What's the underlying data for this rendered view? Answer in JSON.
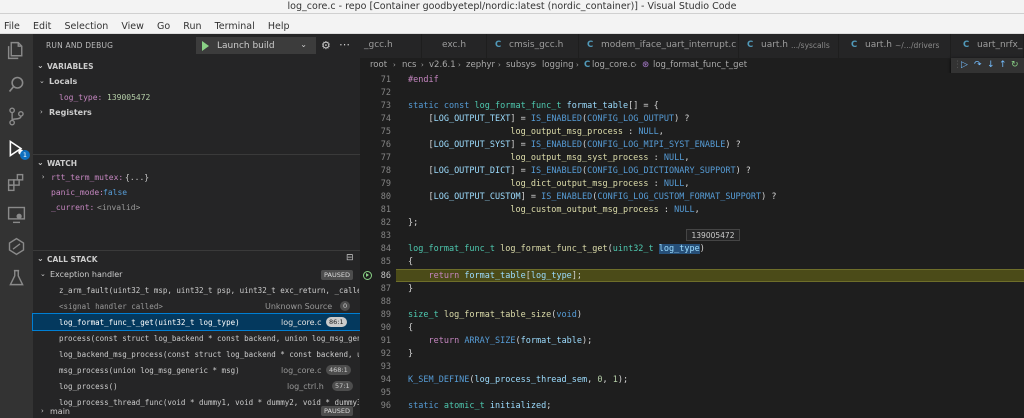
{
  "window": {
    "title": "log_core.c - repo [Container goodbyetepl/nordic:latest (nordic_container)] - Visual Studio Code",
    "menu": [
      "File",
      "Edit",
      "Selection",
      "View",
      "Go",
      "Run",
      "Terminal",
      "Help"
    ]
  },
  "activity": {
    "icons": [
      "explorer-icon",
      "search-icon",
      "source-control-icon",
      "run-debug-icon",
      "extensions-icon",
      "remote-explorer-icon",
      "nrf-connect-icon",
      "testing-icon"
    ],
    "debug_badge": "1"
  },
  "sidebar": {
    "title": "RUN AND DEBUG",
    "launch_label": "Launch build",
    "variables": {
      "title": "VARIABLES",
      "locals_label": "Locals",
      "local_name": "log_type:",
      "local_value": "139005472",
      "registers_label": "Registers"
    },
    "watch": {
      "title": "WATCH",
      "items": [
        {
          "name": "rtt_term_mutex:",
          "value": "{...}"
        },
        {
          "name": "panic_mode:",
          "value": "false"
        },
        {
          "name": "_current:",
          "value": "<invalid>"
        }
      ]
    },
    "call_stack": {
      "title": "CALL STACK",
      "thread_label": "Exception handler",
      "thread_status": "PAUSED",
      "frames": [
        {
          "fn": "z_arm_fault(uint32_t msp, uint32_t psp, uint32_t exc_return, _callee",
          "src": "",
          "pos": ""
        },
        {
          "fn": "<signal handler called>",
          "src": "Unknown Source",
          "pos": "0"
        },
        {
          "fn": "log_format_func_t_get(uint32_t log_type)",
          "src": "log_core.c",
          "pos": "86:1"
        },
        {
          "fn": "process(const struct log_backend * const backend, union log_msg_gene",
          "src": "",
          "pos": ""
        },
        {
          "fn": "log_backend_msg_process(const struct log_backend * const backend, un",
          "src": "",
          "pos": ""
        },
        {
          "fn": "msg_process(union log_msg_generic * msg)",
          "src": "log_core.c",
          "pos": "468:1"
        },
        {
          "fn": "log_process()",
          "src": "log_ctrl.h",
          "pos": "57:1"
        },
        {
          "fn": "log_process_thread_func(void * dummy1, void * dummy2, void * dummy3)",
          "src": "",
          "pos": ""
        }
      ],
      "main_label": "main",
      "main_status": "PAUSED"
    }
  },
  "tabs": [
    {
      "label": "_gcc.h",
      "dir": ""
    },
    {
      "label": "exc.h",
      "dir": ""
    },
    {
      "label": "cmsis_gcc.h",
      "dir": ""
    },
    {
      "label": "modem_iface_uart_interrupt.c",
      "dir": ""
    },
    {
      "label": "uart.h",
      "dir": ".../syscalls"
    },
    {
      "label": "uart.h",
      "dir": "~/.../drivers"
    },
    {
      "label": "uart_nrfx_",
      "dir": ""
    }
  ],
  "breadcrumb": [
    "root",
    "ncs",
    "v2.6.1",
    "zephyr",
    "subsys",
    "logging",
    "log_core.c",
    "log_format_func_t_get"
  ],
  "editor": {
    "hover_value": "139005472",
    "lines": [
      {
        "n": "71",
        "text": "#endif"
      },
      {
        "n": "72",
        "text": ""
      },
      {
        "n": "73",
        "text": "static const log_format_func_t format_table[] = {"
      },
      {
        "n": "74",
        "text": "    [LOG_OUTPUT_TEXT] = IS_ENABLED(CONFIG_LOG_OUTPUT) ?"
      },
      {
        "n": "75",
        "text": "                    log_output_msg_process : NULL,"
      },
      {
        "n": "76",
        "text": "    [LOG_OUTPUT_SYST] = IS_ENABLED(CONFIG_LOG_MIPI_SYST_ENABLE) ?"
      },
      {
        "n": "77",
        "text": "                    log_output_msg_syst_process : NULL,"
      },
      {
        "n": "78",
        "text": "    [LOG_OUTPUT_DICT] = IS_ENABLED(CONFIG_LOG_DICTIONARY_SUPPORT) ?"
      },
      {
        "n": "79",
        "text": "                    log_dict_output_msg_process : NULL,"
      },
      {
        "n": "80",
        "text": "    [LOG_OUTPUT_CUSTOM] = IS_ENABLED(CONFIG_LOG_CUSTOM_FORMAT_SUPPORT) ?"
      },
      {
        "n": "81",
        "text": "                    log_custom_output_msg_process : NULL,"
      },
      {
        "n": "82",
        "text": "};"
      },
      {
        "n": "83",
        "text": ""
      },
      {
        "n": "84",
        "text": "log_format_func_t log_format_func_t_get(uint32_t log_type)"
      },
      {
        "n": "85",
        "text": "{"
      },
      {
        "n": "86",
        "text": "    return format_table[log_type];"
      },
      {
        "n": "87",
        "text": "}"
      },
      {
        "n": "88",
        "text": ""
      },
      {
        "n": "89",
        "text": "size_t log_format_table_size(void)"
      },
      {
        "n": "90",
        "text": "{"
      },
      {
        "n": "91",
        "text": "    return ARRAY_SIZE(format_table);"
      },
      {
        "n": "92",
        "text": "}"
      },
      {
        "n": "93",
        "text": ""
      },
      {
        "n": "94",
        "text": "K_SEM_DEFINE(log_process_thread_sem, 0, 1);"
      },
      {
        "n": "95",
        "text": ""
      },
      {
        "n": "96",
        "text": "static atomic_t initialized;"
      }
    ]
  }
}
